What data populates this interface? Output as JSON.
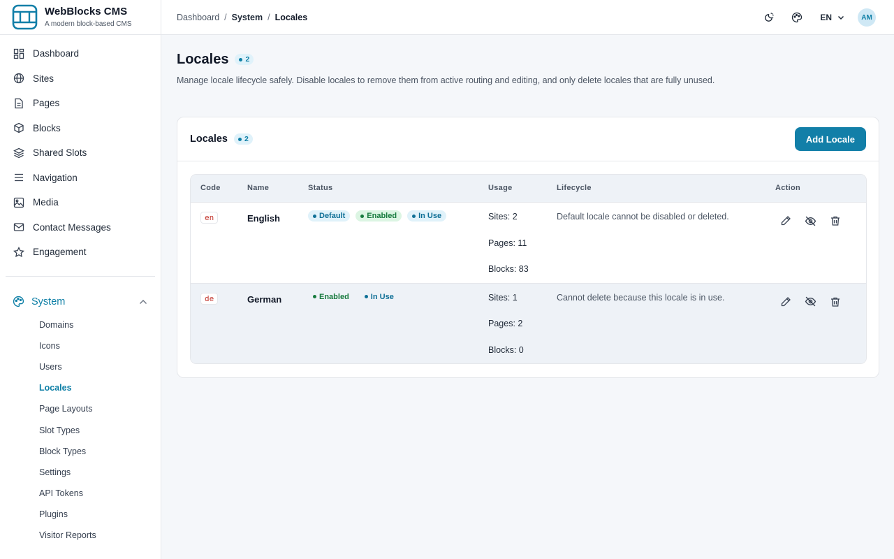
{
  "brand": {
    "title": "WebBlocks CMS",
    "subtitle": "A modern block-based CMS"
  },
  "sidebar": {
    "items": [
      {
        "label": "Dashboard",
        "icon": "dashboard-icon"
      },
      {
        "label": "Sites",
        "icon": "globe-icon"
      },
      {
        "label": "Pages",
        "icon": "file-icon"
      },
      {
        "label": "Blocks",
        "icon": "cube-icon"
      },
      {
        "label": "Shared Slots",
        "icon": "layers-icon"
      },
      {
        "label": "Navigation",
        "icon": "menu-icon"
      },
      {
        "label": "Media",
        "icon": "image-icon"
      },
      {
        "label": "Contact Messages",
        "icon": "mail-icon"
      },
      {
        "label": "Engagement",
        "icon": "star-icon"
      }
    ],
    "system": {
      "label": "System",
      "children": [
        "Domains",
        "Icons",
        "Users",
        "Locales",
        "Page Layouts",
        "Slot Types",
        "Block Types",
        "Settings",
        "API Tokens",
        "Plugins",
        "Visitor Reports"
      ],
      "active": "Locales"
    }
  },
  "topbar": {
    "breadcrumbs": [
      "Dashboard",
      "System",
      "Locales"
    ],
    "language": "EN",
    "avatar": "AM"
  },
  "page": {
    "title": "Locales",
    "count": "2",
    "description": "Manage locale lifecycle safely. Disable locales to remove them from active routing and editing, and only delete locales that are fully unused."
  },
  "card": {
    "title": "Locales",
    "count": "2",
    "add_label": "Add Locale"
  },
  "table": {
    "headers": [
      "Code",
      "Name",
      "Status",
      "Usage",
      "Lifecycle",
      "Action"
    ],
    "rows": [
      {
        "code": "en",
        "name": "English",
        "badges": [
          "Default",
          "Enabled",
          "In Use"
        ],
        "usage": [
          "Sites: 2",
          "Pages: 11",
          "Blocks: 83"
        ],
        "lifecycle": "Default locale cannot be disabled or deleted."
      },
      {
        "code": "de",
        "name": "German",
        "badges": [
          "Enabled",
          "In Use"
        ],
        "usage": [
          "Sites: 1",
          "Pages: 2",
          "Blocks: 0"
        ],
        "lifecycle": "Cannot delete because this locale is in use."
      }
    ]
  },
  "colors": {
    "accent": "#127fa8",
    "badge_blue": "#0e6f96",
    "badge_green": "#167a3d",
    "code_red": "#c2332b"
  }
}
